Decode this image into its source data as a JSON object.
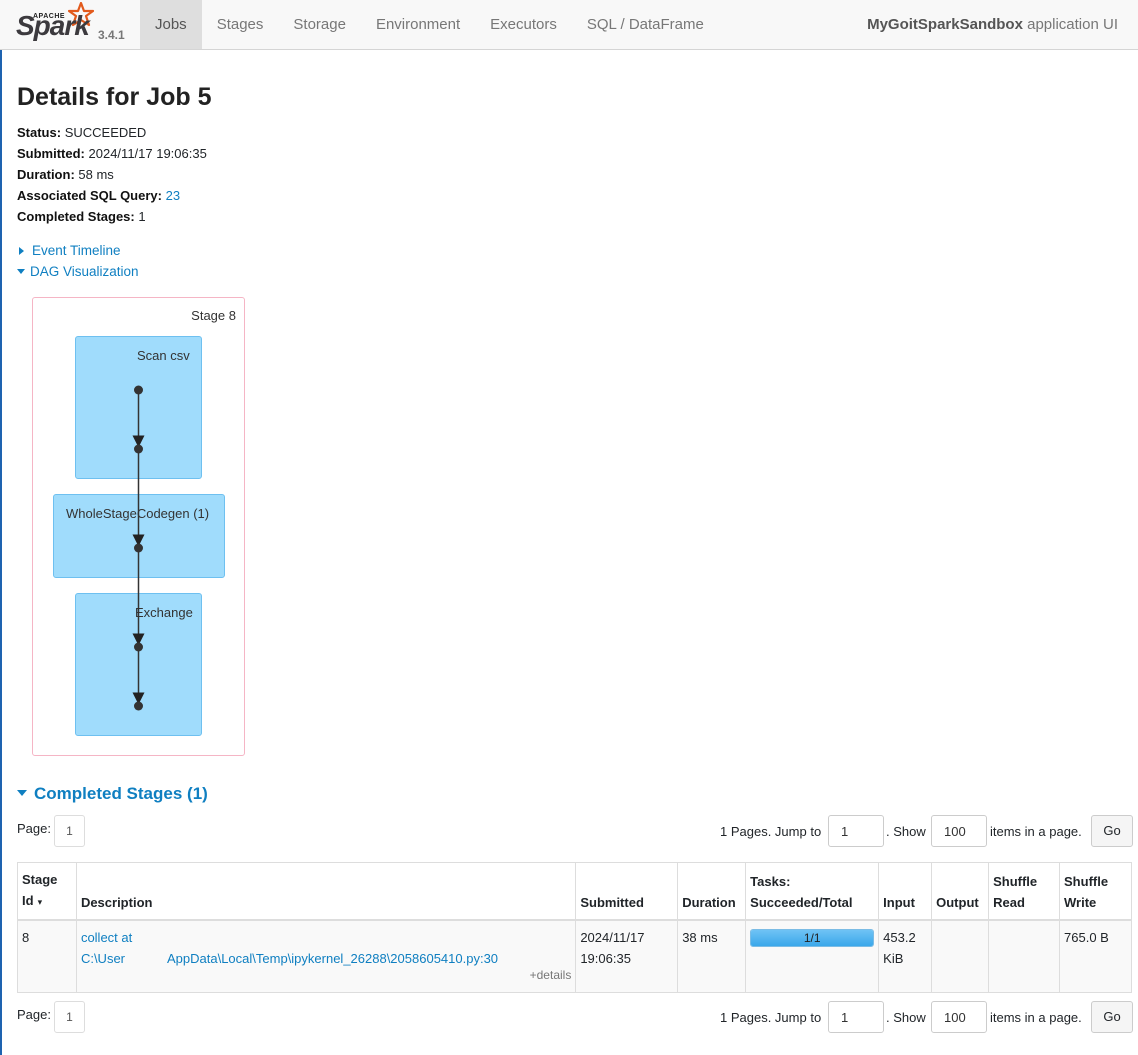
{
  "nav": {
    "logo": {
      "apache": "APACHE",
      "spark": "Spark",
      "version": "3.4.1"
    },
    "tabs": [
      {
        "label": "Jobs",
        "active": true
      },
      {
        "label": "Stages"
      },
      {
        "label": "Storage"
      },
      {
        "label": "Environment"
      },
      {
        "label": "Executors"
      },
      {
        "label": "SQL / DataFrame"
      }
    ],
    "app_name": "MyGoitSparkSandbox",
    "app_suffix": "application UI"
  },
  "page": {
    "title": "Details for Job 5",
    "summary": {
      "status_label": "Status:",
      "status_value": "SUCCEEDED",
      "submitted_label": "Submitted:",
      "submitted_value": "2024/11/17 19:06:35",
      "duration_label": "Duration:",
      "duration_value": "58 ms",
      "sql_label": "Associated SQL Query:",
      "sql_value": "23",
      "completed_label": "Completed Stages:",
      "completed_value": "1"
    },
    "event_timeline": "Event Timeline",
    "dag_visualization": "DAG Visualization"
  },
  "dag": {
    "stage_label": "Stage 8",
    "clusters": [
      "Scan csv",
      "WholeStageCodegen (1)",
      "Exchange"
    ],
    "colors": {
      "stage_border": "#f5b5c5",
      "cluster_fill": "#a0dcfc",
      "edge": "#333333"
    }
  },
  "completed_stages": {
    "title": "Completed Stages (1)",
    "pager": {
      "page_label": "Page:",
      "page_number": "1",
      "pages_text": "1 Pages. Jump to",
      "jump_value": "1",
      "show_text": ". Show",
      "page_size": "100",
      "items_text": "items in a page.",
      "go_label": "Go"
    },
    "columns": {
      "stage_id_1": "Stage",
      "stage_id_2": "Id",
      "sort_indicator": "▾",
      "description": "Description",
      "submitted": "Submitted",
      "duration": "Duration",
      "tasks_1": "Tasks:",
      "tasks_2": "Succeeded/Total",
      "input": "Input",
      "output": "Output",
      "shuffle_read_1": "Shuffle",
      "shuffle_read_2": "Read",
      "shuffle_write_1": "Shuffle",
      "shuffle_write_2": "Write"
    },
    "rows": [
      {
        "stage_id": "8",
        "desc_line1": "collect at",
        "desc_line2_start": "C:\\User",
        "desc_line2_end": "AppData\\Local\\Temp\\ipykernel_26288\\2058605410.py:30",
        "details": "+details",
        "submitted_date": "2024/11/17",
        "submitted_time": "19:06:35",
        "duration": "38 ms",
        "tasks_text": "1/1",
        "tasks_fraction": 1.0,
        "input_1": "453.2",
        "input_2": "KiB",
        "output": "",
        "shuffle_read": "",
        "shuffle_write": "765.0 B"
      }
    ]
  }
}
